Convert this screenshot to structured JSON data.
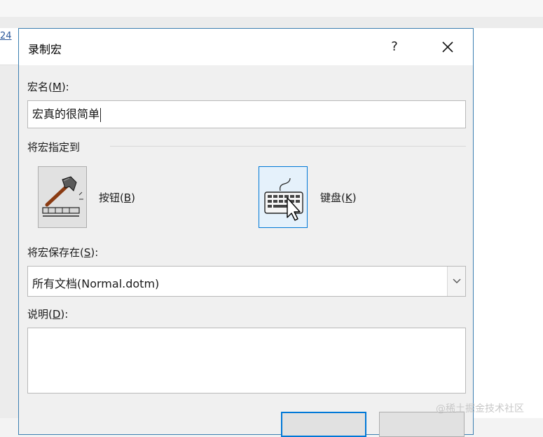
{
  "background": {
    "partial_link_text": "24"
  },
  "dialog": {
    "title": "录制宏",
    "help_label": "?",
    "close_label": "✕",
    "macro_name": {
      "label_prefix": "宏名(",
      "label_key": "M",
      "label_suffix": "):",
      "value": "宏真的很简单"
    },
    "assign_to": {
      "group_label": "将宏指定到",
      "button_option": {
        "label_prefix": "按钮(",
        "label_key": "B",
        "label_suffix": ")",
        "icon": "hammer-icon"
      },
      "keyboard_option": {
        "label_prefix": "键盘(",
        "label_key": "K",
        "label_suffix": ")",
        "icon": "keyboard-icon"
      }
    },
    "store_in": {
      "label_prefix": "将宏保存在(",
      "label_key": "S",
      "label_suffix": "):",
      "selected": "所有文档(Normal.dotm)"
    },
    "description": {
      "label_prefix": "说明(",
      "label_key": "D",
      "label_suffix": "):",
      "value": ""
    }
  },
  "watermark": "@稀土掘金技术社区",
  "colors": {
    "accent": "#0078d7",
    "dialog_border": "#3c7fb1"
  }
}
